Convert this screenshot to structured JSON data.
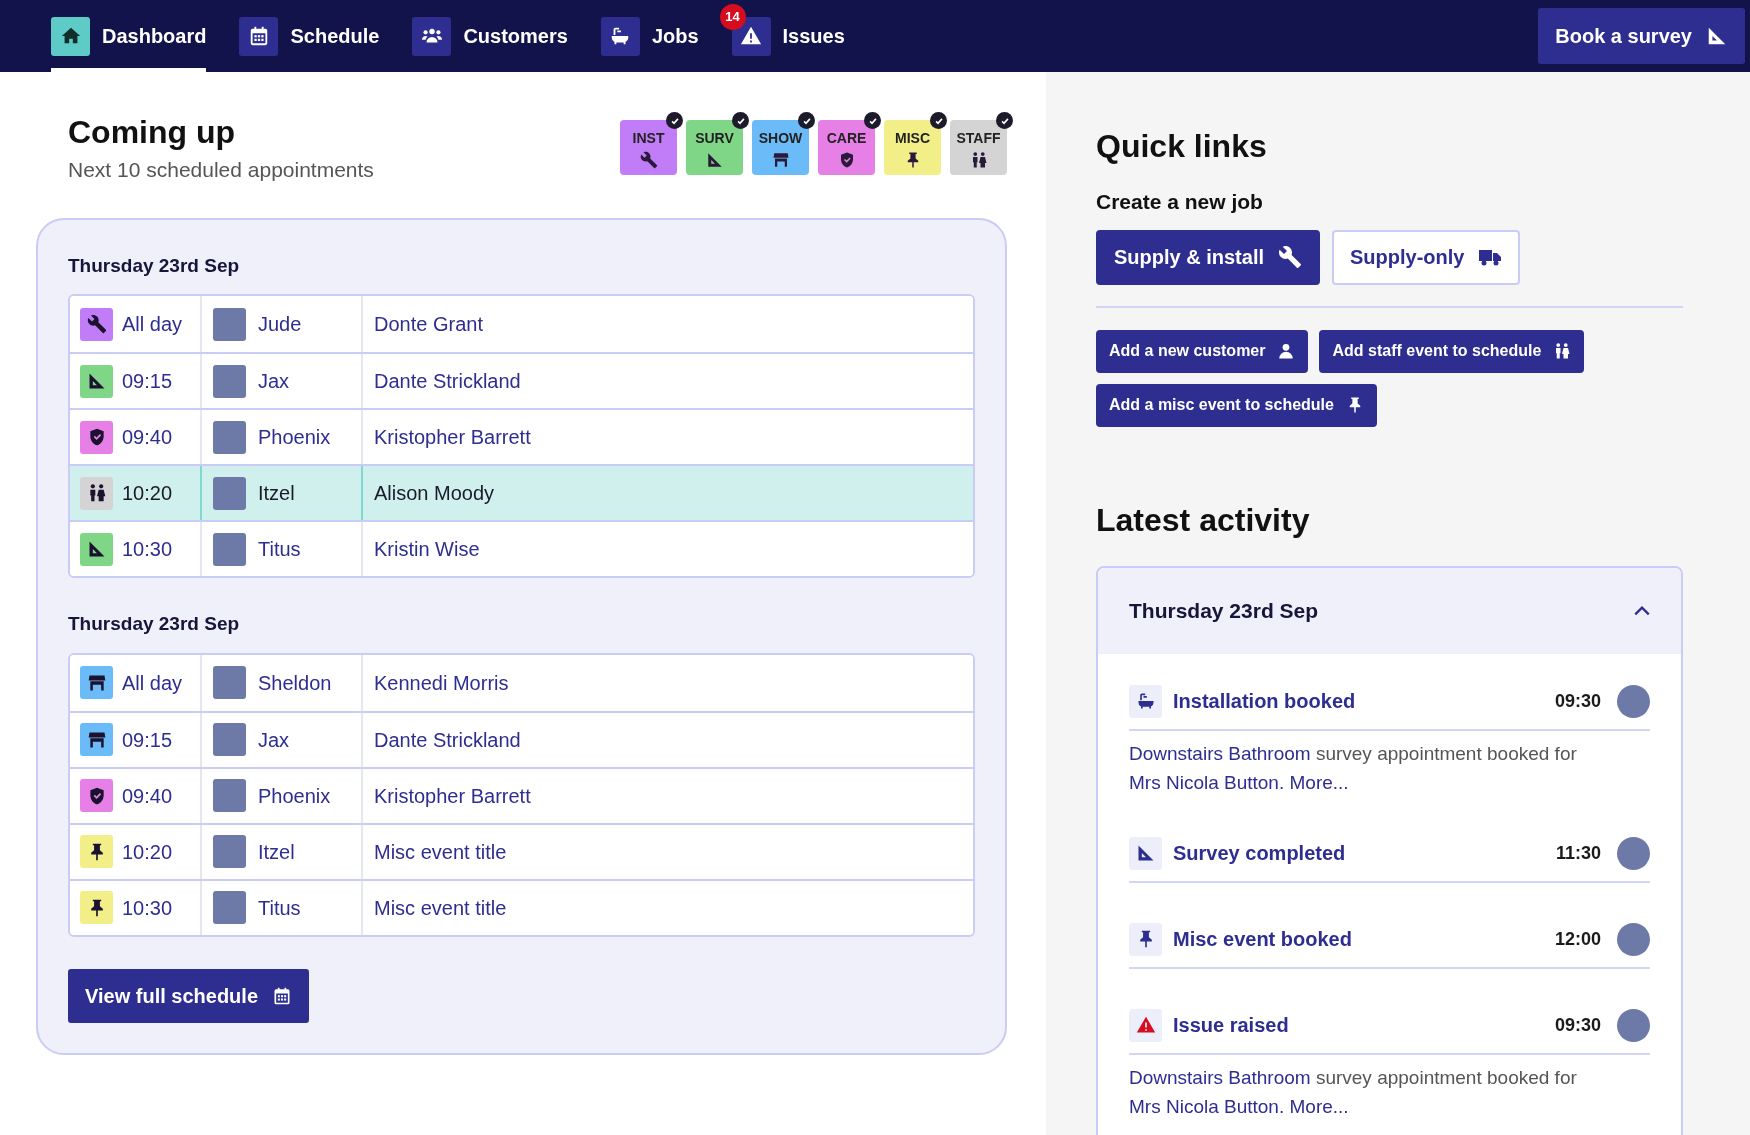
{
  "nav": {
    "items": [
      {
        "label": "Dashboard",
        "selected": true
      },
      {
        "label": "Schedule",
        "selected": false
      },
      {
        "label": "Customers",
        "selected": false
      },
      {
        "label": "Jobs",
        "selected": false
      },
      {
        "label": "Issues",
        "selected": false,
        "badge": "14"
      }
    ],
    "action": "Book a survey"
  },
  "coming_up": {
    "title": "Coming up",
    "subtitle": "Next 10 scheduled appointments",
    "filters": [
      {
        "kind": "inst",
        "label": "INST",
        "color": "#c17cf7",
        "checked": true
      },
      {
        "kind": "surv",
        "label": "SURV",
        "color": "#7fd687",
        "checked": true
      },
      {
        "kind": "show",
        "label": "SHOW",
        "color": "#6bbbf8",
        "checked": true
      },
      {
        "kind": "care",
        "label": "CARE",
        "color": "#e67fe6",
        "checked": true
      },
      {
        "kind": "misc",
        "label": "MISC",
        "color": "#f3ef88",
        "checked": true
      },
      {
        "kind": "staff",
        "label": "STAFF",
        "color": "#d4d4d4",
        "checked": true
      }
    ],
    "groups": [
      {
        "date": "Thursday 23rd Sep",
        "rows": [
          {
            "kind": "inst",
            "time": "All day",
            "staff": "Jude",
            "customer": "Donte Grant",
            "selected": false
          },
          {
            "kind": "surv",
            "time": "09:15",
            "staff": "Jax",
            "customer": "Dante Strickland",
            "selected": false
          },
          {
            "kind": "care",
            "time": "09:40",
            "staff": "Phoenix",
            "customer": "Kristopher Barrett",
            "selected": false
          },
          {
            "kind": "staff",
            "time": "10:20",
            "staff": "Itzel",
            "customer": "Alison Moody",
            "selected": true
          },
          {
            "kind": "surv",
            "time": "10:30",
            "staff": "Titus",
            "customer": "Kristin Wise",
            "selected": false
          }
        ]
      },
      {
        "date": "Thursday 23rd Sep",
        "rows": [
          {
            "kind": "show",
            "time": "All day",
            "staff": "Sheldon",
            "customer": "Kennedi Morris",
            "selected": false
          },
          {
            "kind": "show",
            "time": "09:15",
            "staff": "Jax",
            "customer": "Dante Strickland",
            "selected": false
          },
          {
            "kind": "care",
            "time": "09:40",
            "staff": "Phoenix",
            "customer": "Kristopher Barrett",
            "selected": false
          },
          {
            "kind": "misc",
            "time": "10:20",
            "staff": "Itzel",
            "customer": "Misc event title",
            "selected": false
          },
          {
            "kind": "misc",
            "time": "10:30",
            "staff": "Titus",
            "customer": "Misc event title",
            "selected": false
          }
        ]
      }
    ],
    "button": "View full schedule"
  },
  "quick_links": {
    "title": "Quick links",
    "subtitle": "Create a new job",
    "job_buttons": [
      {
        "label": "Supply & install",
        "kind": "primary"
      },
      {
        "label": "Supply-only",
        "kind": "outline"
      }
    ],
    "buttons": [
      "Add a new customer",
      "Add staff event to schedule",
      "Add a misc event to schedule"
    ]
  },
  "latest_activity": {
    "title": "Latest activity",
    "date": "Thursday 23rd Sep",
    "expanded": true,
    "items": [
      {
        "kind": "installation",
        "title": "Installation booked",
        "time": "09:30",
        "description": {
          "room": "Downstairs Bathroom",
          "text": "survey appointment booked for",
          "customer": "Mrs Nicola Button.",
          "more": "More..."
        }
      },
      {
        "kind": "survey",
        "title": "Survey completed",
        "time": "11:30"
      },
      {
        "kind": "misc",
        "title": "Misc event booked",
        "time": "12:00"
      },
      {
        "kind": "issue",
        "title": "Issue raised",
        "time": "09:30",
        "description": {
          "room": "Downstairs Bathroom",
          "text": "survey appointment booked for",
          "customer": "Mrs Nicola Button.",
          "more": "More..."
        }
      }
    ]
  }
}
